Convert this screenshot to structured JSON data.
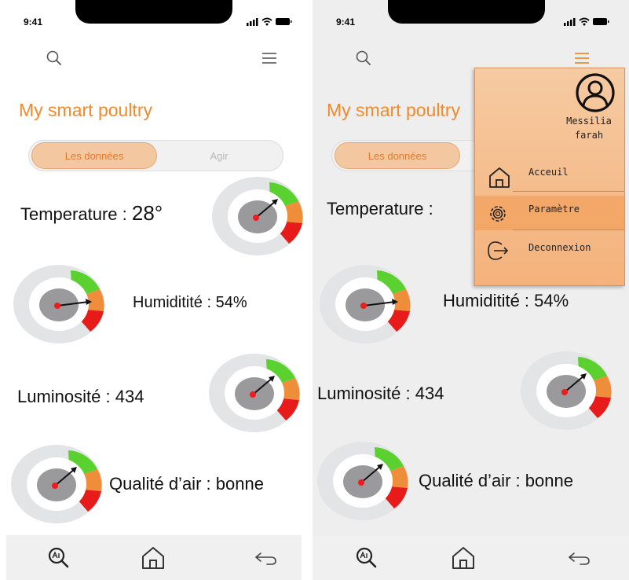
{
  "status_bar": {
    "time": "9:41"
  },
  "app": {
    "title": "My smart poultry"
  },
  "tabs": {
    "active": "Les données",
    "inactive": "Agir"
  },
  "metrics": {
    "temperature": {
      "label": "Temperature :",
      "value": "28°"
    },
    "humidity": {
      "label": "Humiditité :",
      "value": "54%"
    },
    "luminosity": {
      "label": "Luminosité :",
      "value": "434"
    },
    "air_quality": {
      "label": "Qualité d’air :",
      "value": "bonne"
    }
  },
  "drawer": {
    "user_name_line1": "Messilia",
    "user_name_line2": "farah",
    "items": [
      {
        "label": "Acceuil",
        "icon": "home-icon"
      },
      {
        "label": "Paramètre",
        "icon": "gear-icon"
      },
      {
        "label": "Deconnexion",
        "icon": "logout-icon"
      }
    ]
  },
  "bottom_nav": {
    "items": [
      {
        "icon": "search-magnifier-icon"
      },
      {
        "icon": "home-icon"
      },
      {
        "icon": "back-arrow-icon"
      }
    ]
  },
  "colors": {
    "accent": "#ef8a2d",
    "gauge_green": "#5bd12f",
    "gauge_orange": "#ef8e3a",
    "gauge_red": "#e81b1b",
    "drawer_bg": "#f4b27b"
  }
}
